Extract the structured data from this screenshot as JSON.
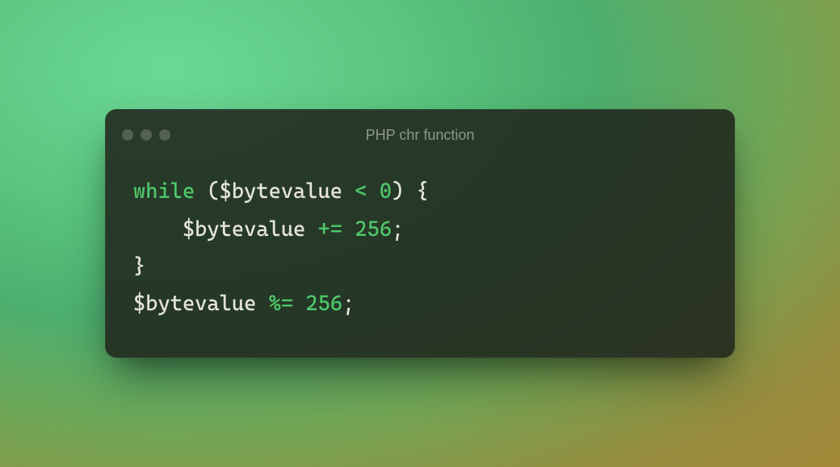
{
  "window": {
    "title": "PHP chr function"
  },
  "code": {
    "tokens": [
      [
        {
          "t": "while",
          "c": "tok-keyword"
        },
        {
          "t": " (",
          "c": "tok-punc"
        },
        {
          "t": "$bytevalue",
          "c": "tok-var"
        },
        {
          "t": " ",
          "c": "tok-punc"
        },
        {
          "t": "<",
          "c": "tok-op"
        },
        {
          "t": " ",
          "c": "tok-punc"
        },
        {
          "t": "0",
          "c": "tok-num"
        },
        {
          "t": ") {",
          "c": "tok-punc"
        }
      ],
      [
        {
          "t": "    ",
          "c": "tok-punc"
        },
        {
          "t": "$bytevalue",
          "c": "tok-var"
        },
        {
          "t": " ",
          "c": "tok-punc"
        },
        {
          "t": "+=",
          "c": "tok-op"
        },
        {
          "t": " ",
          "c": "tok-punc"
        },
        {
          "t": "256",
          "c": "tok-num"
        },
        {
          "t": ";",
          "c": "tok-punc"
        }
      ],
      [
        {
          "t": "}",
          "c": "tok-punc"
        }
      ],
      [
        {
          "t": "$bytevalue",
          "c": "tok-var"
        },
        {
          "t": " ",
          "c": "tok-punc"
        },
        {
          "t": "%=",
          "c": "tok-op"
        },
        {
          "t": " ",
          "c": "tok-punc"
        },
        {
          "t": "256",
          "c": "tok-num"
        },
        {
          "t": ";",
          "c": "tok-punc"
        }
      ]
    ]
  }
}
